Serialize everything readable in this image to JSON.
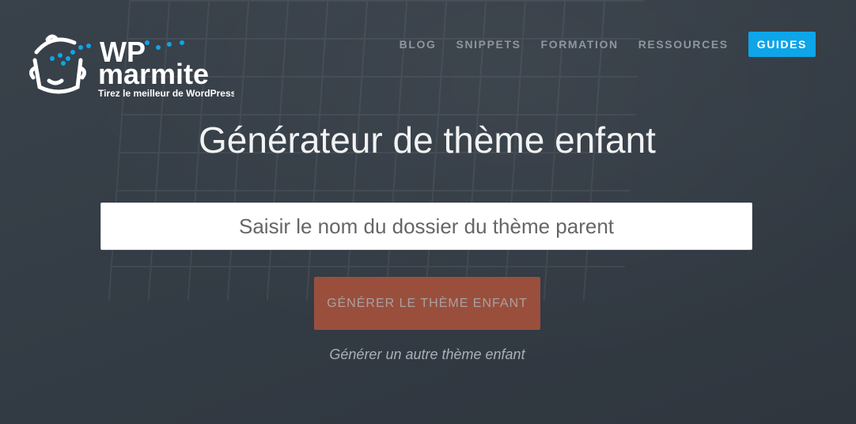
{
  "logo": {
    "brand_top": "WP",
    "brand_bottom": "marmite",
    "tagline": "Tirez le meilleur de WordPress"
  },
  "nav": {
    "items": [
      "BLOG",
      "SNIPPETS",
      "FORMATION",
      "RESSOURCES"
    ],
    "cta": "GUIDES"
  },
  "colors": {
    "accent": "#0ea5e9",
    "button": "#9a4f3d",
    "background": "#343c45"
  },
  "main": {
    "title": "Générateur de thème enfant",
    "input_placeholder": "Saisir le nom du dossier du thème parent",
    "generate_button": "GÉNÉRER LE THÈME ENFANT",
    "other_link": "Générer un autre thème enfant"
  }
}
